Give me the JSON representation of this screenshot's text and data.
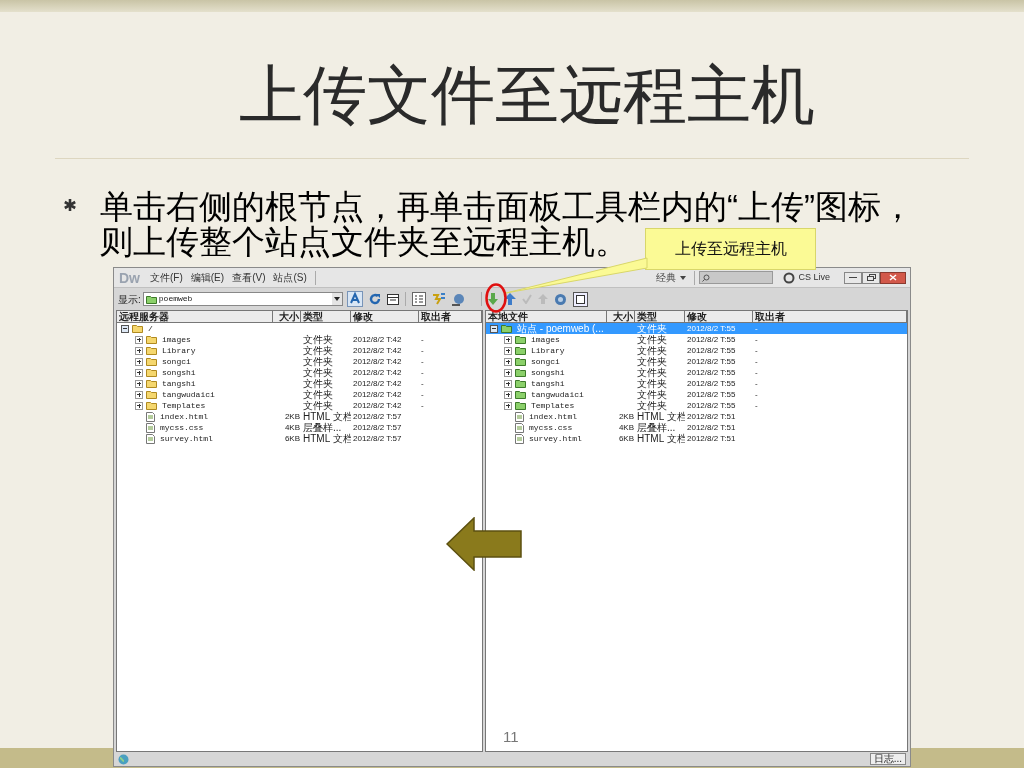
{
  "slide": {
    "title": "上传文件至远程主机",
    "bullet_lines": [
      "单击右侧的根节点，再单击面板工具栏内的“上传”图标，",
      "则上传整个站点文件夹至远程主机。"
    ],
    "callout": "上传至远程主机",
    "page_number": "11"
  },
  "app": {
    "logo": "Dw",
    "menus": [
      "文件(F)",
      "编辑(E)",
      "查看(V)",
      "站点(S)"
    ],
    "workspace": "经典",
    "cs_live": "CS Live",
    "display_label": "显示:",
    "site": "poemweb",
    "log_button": "日志..."
  },
  "panes": [
    {
      "kind": "remote",
      "columns": [
        "远程服务器",
        "大小",
        "类型",
        "修改",
        "取出者"
      ],
      "tree": [
        {
          "kind": "folder",
          "name": "/",
          "expanded": true,
          "selected": false,
          "children": [
            {
              "kind": "folder",
              "name": "images",
              "type": "文件夹",
              "modified": "2012/8/2 T:42",
              "checked_out": "-",
              "expanded": false,
              "selected": false
            },
            {
              "kind": "folder",
              "name": "Library",
              "type": "文件夹",
              "modified": "2012/8/2 T:42",
              "checked_out": "-",
              "expanded": false,
              "selected": false
            },
            {
              "kind": "folder",
              "name": "songci",
              "type": "文件夹",
              "modified": "2012/8/2 T:42",
              "checked_out": "-",
              "expanded": false,
              "selected": false
            },
            {
              "kind": "folder",
              "name": "songshi",
              "type": "文件夹",
              "modified": "2012/8/2 T:42",
              "checked_out": "-",
              "expanded": false,
              "selected": false
            },
            {
              "kind": "folder",
              "name": "tangshi",
              "type": "文件夹",
              "modified": "2012/8/2 T:42",
              "checked_out": "-",
              "expanded": false,
              "selected": false
            },
            {
              "kind": "folder",
              "name": "tangwudaici",
              "type": "文件夹",
              "modified": "2012/8/2 T:42",
              "checked_out": "-",
              "expanded": false,
              "selected": false
            },
            {
              "kind": "folder",
              "name": "Templates",
              "type": "文件夹",
              "modified": "2012/8/2 T:42",
              "checked_out": "-",
              "expanded": false,
              "selected": false
            },
            {
              "kind": "file",
              "name": "index.html",
              "size": "2KB",
              "type": "HTML 文档",
              "modified": "2012/8/2 T:57",
              "selected": false
            },
            {
              "kind": "file",
              "name": "mycss.css",
              "size": "4KB",
              "type": "层叠样...",
              "modified": "2012/8/2 T:57",
              "selected": false
            },
            {
              "kind": "file",
              "name": "survey.html",
              "size": "6KB",
              "type": "HTML 文档",
              "modified": "2012/8/2 T:57",
              "selected": false
            }
          ]
        }
      ]
    },
    {
      "kind": "local",
      "columns": [
        "本地文件",
        "大小",
        "类型",
        "修改",
        "取出者"
      ],
      "tree": [
        {
          "kind": "folder",
          "name": "站点 - poemweb (...",
          "type": "文件夹",
          "modified": "2012/8/2 T:55",
          "checked_out": "-",
          "expanded": true,
          "selected": true,
          "children": [
            {
              "kind": "folder",
              "name": "images",
              "type": "文件夹",
              "modified": "2012/8/2 T:55",
              "checked_out": "-",
              "expanded": false,
              "selected": false
            },
            {
              "kind": "folder",
              "name": "Library",
              "type": "文件夹",
              "modified": "2012/8/2 T:55",
              "checked_out": "-",
              "expanded": false,
              "selected": false
            },
            {
              "kind": "folder",
              "name": "songci",
              "type": "文件夹",
              "modified": "2012/8/2 T:55",
              "checked_out": "-",
              "expanded": false,
              "selected": false
            },
            {
              "kind": "folder",
              "name": "songshi",
              "type": "文件夹",
              "modified": "2012/8/2 T:55",
              "checked_out": "-",
              "expanded": false,
              "selected": false
            },
            {
              "kind": "folder",
              "name": "tangshi",
              "type": "文件夹",
              "modified": "2012/8/2 T:55",
              "checked_out": "-",
              "expanded": false,
              "selected": false
            },
            {
              "kind": "folder",
              "name": "tangwudaici",
              "type": "文件夹",
              "modified": "2012/8/2 T:55",
              "checked_out": "-",
              "expanded": false,
              "selected": false
            },
            {
              "kind": "folder",
              "name": "Templates",
              "type": "文件夹",
              "modified": "2012/8/2 T:55",
              "checked_out": "-",
              "expanded": false,
              "selected": false
            },
            {
              "kind": "file",
              "name": "index.html",
              "size": "2KB",
              "type": "HTML 文档",
              "modified": "2012/8/2 T:51",
              "selected": false
            },
            {
              "kind": "file",
              "name": "mycss.css",
              "size": "4KB",
              "type": "层叠样...",
              "modified": "2012/8/2 T:51",
              "selected": false
            },
            {
              "kind": "file",
              "name": "survey.html",
              "size": "6KB",
              "type": "HTML 文档",
              "modified": "2012/8/2 T:51",
              "selected": false
            }
          ]
        }
      ]
    }
  ]
}
